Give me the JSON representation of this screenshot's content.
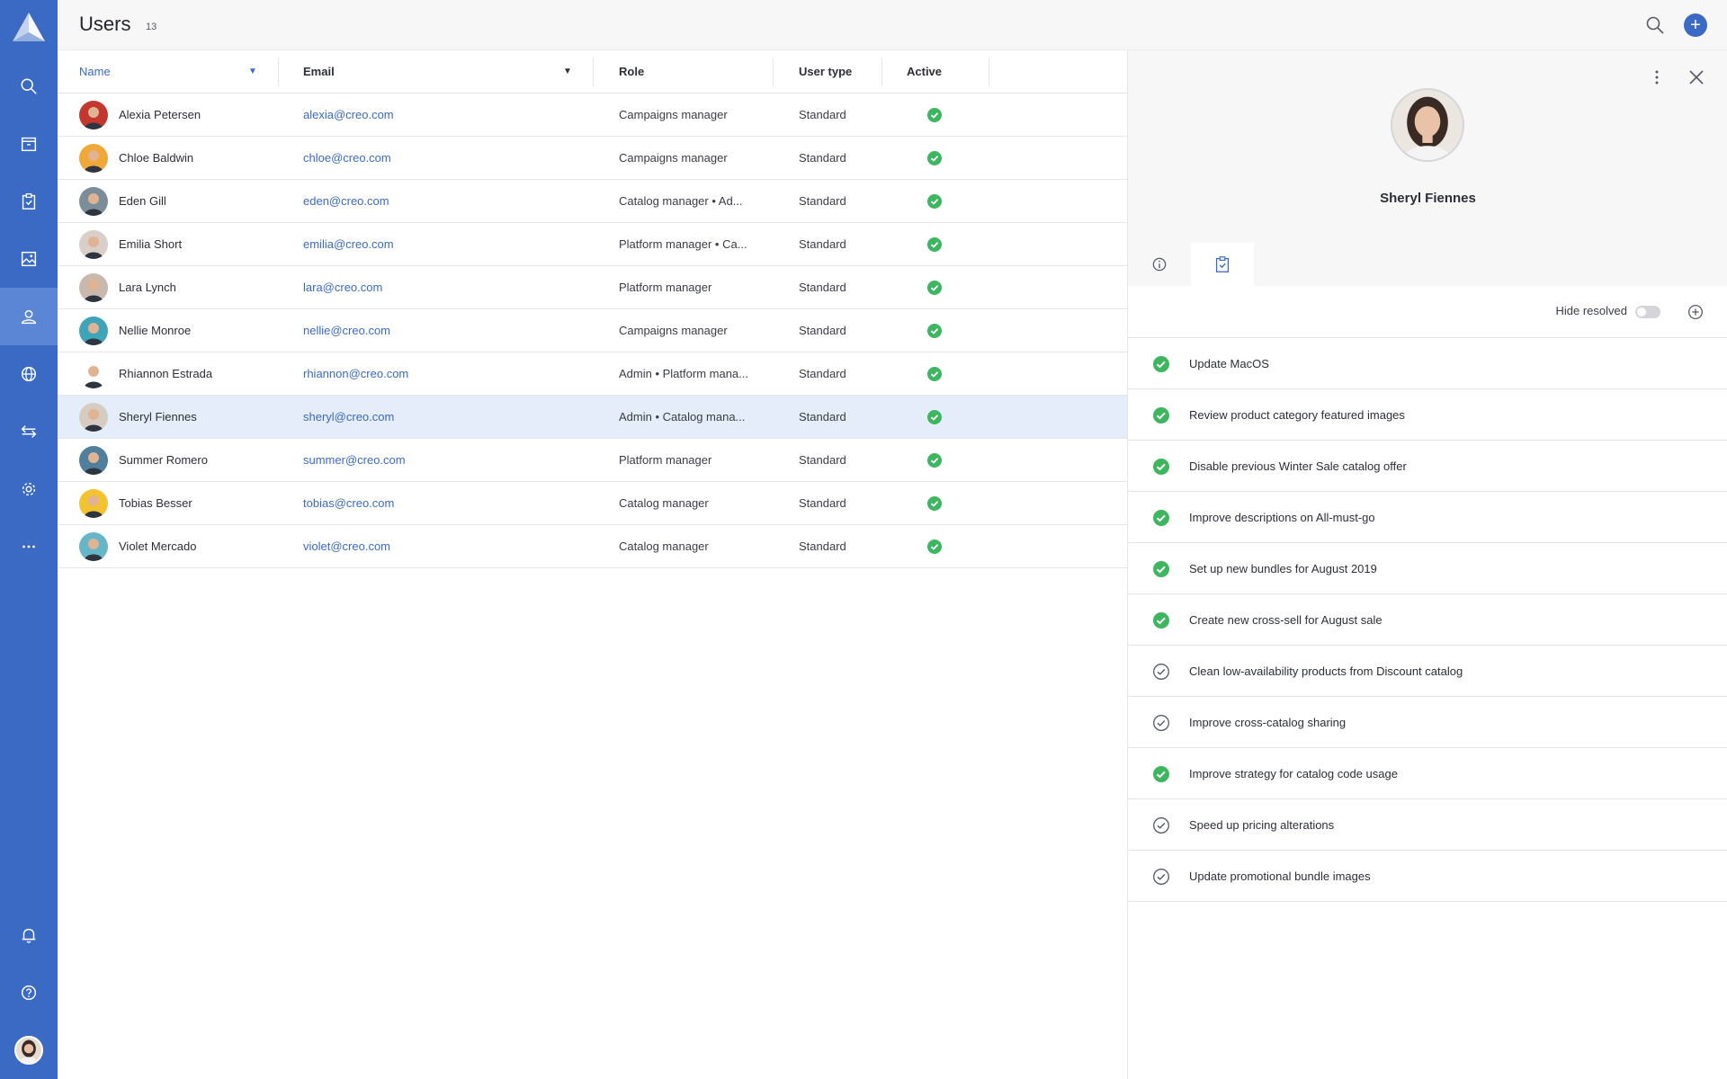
{
  "brand": {
    "accent": "#3b6ac4",
    "success": "#3eb660"
  },
  "sidebar": {
    "items": [
      {
        "icon": "search-icon"
      },
      {
        "icon": "archive-icon"
      },
      {
        "icon": "clipboard-check-icon"
      },
      {
        "icon": "image-icon"
      },
      {
        "icon": "user-icon",
        "active": true
      },
      {
        "icon": "globe-icon"
      },
      {
        "icon": "transfer-arrows-icon"
      },
      {
        "icon": "gear-icon"
      },
      {
        "icon": "more-icon"
      },
      {
        "icon": "bell-icon"
      },
      {
        "icon": "help-icon"
      }
    ]
  },
  "header": {
    "title": "Users",
    "count": "13"
  },
  "table": {
    "columns": {
      "name": "Name",
      "email": "Email",
      "role": "Role",
      "user_type": "User type",
      "active": "Active"
    },
    "rows": [
      {
        "name": "Alexia Petersen",
        "email": "alexia@creo.com",
        "role": "Campaigns manager",
        "type": "Standard",
        "active": true
      },
      {
        "name": "Chloe Baldwin",
        "email": "chloe@creo.com",
        "role": "Campaigns manager",
        "type": "Standard",
        "active": true
      },
      {
        "name": "Eden Gill",
        "email": "eden@creo.com",
        "role": "Catalog manager • Ad...",
        "type": "Standard",
        "active": true
      },
      {
        "name": "Emilia Short",
        "email": "emilia@creo.com",
        "role": "Platform manager • Ca...",
        "type": "Standard",
        "active": true
      },
      {
        "name": "Lara Lynch",
        "email": "lara@creo.com",
        "role": "Platform manager",
        "type": "Standard",
        "active": true
      },
      {
        "name": "Nellie Monroe",
        "email": "nellie@creo.com",
        "role": "Campaigns manager",
        "type": "Standard",
        "active": true
      },
      {
        "name": "Rhiannon Estrada",
        "email": "rhiannon@creo.com",
        "role": "Admin • Platform mana...",
        "type": "Standard",
        "active": true
      },
      {
        "name": "Sheryl Fiennes",
        "email": "sheryl@creo.com",
        "role": "Admin • Catalog mana...",
        "type": "Standard",
        "active": true,
        "selected": true
      },
      {
        "name": "Summer Romero",
        "email": "summer@creo.com",
        "role": "Platform manager",
        "type": "Standard",
        "active": true
      },
      {
        "name": "Tobias Besser",
        "email": "tobias@creo.com",
        "role": "Catalog manager",
        "type": "Standard",
        "active": true
      },
      {
        "name": "Violet Mercado",
        "email": "violet@creo.com",
        "role": "Catalog manager",
        "type": "Standard",
        "active": true
      }
    ]
  },
  "panel": {
    "name": "Sheryl Fiennes",
    "tabs": [
      {
        "icon": "info-icon"
      },
      {
        "icon": "clipboard-check-icon",
        "selected": true
      }
    ],
    "hide_resolved_label": "Hide resolved",
    "tasks": [
      {
        "label": "Update MacOS",
        "resolved": true
      },
      {
        "label": "Review product category featured images",
        "resolved": true
      },
      {
        "label": "Disable previous Winter Sale catalog offer",
        "resolved": true
      },
      {
        "label": "Improve descriptions on All-must-go",
        "resolved": true
      },
      {
        "label": "Set up new bundles for August 2019",
        "resolved": true
      },
      {
        "label": "Create new cross-sell for August sale",
        "resolved": true
      },
      {
        "label": "Clean low-availability products from Discount catalog",
        "resolved": false
      },
      {
        "label": "Improve cross-catalog sharing",
        "resolved": false
      },
      {
        "label": "Improve strategy for catalog code usage",
        "resolved": true
      },
      {
        "label": "Speed up pricing alterations",
        "resolved": false
      },
      {
        "label": "Update promotional bundle images",
        "resolved": false
      }
    ]
  }
}
